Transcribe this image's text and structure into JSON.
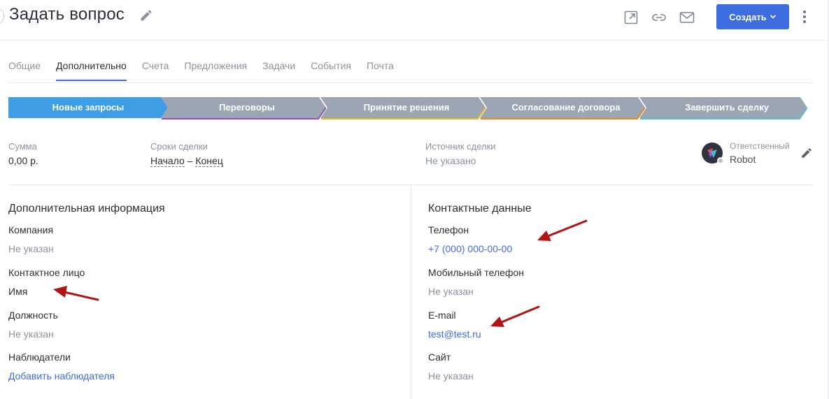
{
  "header": {
    "title": "Задать вопрос",
    "create_label": "Создать",
    "accent": "#3d6de0"
  },
  "icons": [
    "edit-icon",
    "open-external-icon",
    "link-icon",
    "mail-icon",
    "chevron-down-icon",
    "more-vertical-icon"
  ],
  "tabs": [
    {
      "label": "Общие",
      "active": false
    },
    {
      "label": "Дополнительно",
      "active": true
    },
    {
      "label": "Счета",
      "active": false
    },
    {
      "label": "Предложения",
      "active": false
    },
    {
      "label": "Задачи",
      "active": false
    },
    {
      "label": "События",
      "active": false
    },
    {
      "label": "Почта",
      "active": false
    }
  ],
  "pipeline": [
    {
      "label": "Новые запросы",
      "color": "#3d9ee5",
      "active": true
    },
    {
      "label": "Переговоры",
      "color": "#9ba5b3",
      "underline": "#8e54b7"
    },
    {
      "label": "Принятие решения",
      "color": "#9ba5b3",
      "underline": "#e6b820"
    },
    {
      "label": "Согласование договора",
      "color": "#9ba5b3",
      "underline": "#e88a1f"
    },
    {
      "label": "Завершить сделку",
      "color": "#9ba5b3",
      "underline": "#5bc0c8"
    }
  ],
  "summary": {
    "sum_label": "Сумма",
    "sum_value": "0,00 р.",
    "terms_label": "Сроки сделки",
    "terms_start": "Начало",
    "terms_sep": "–",
    "terms_end": "Конец",
    "source_label": "Источник сделки",
    "source_value": "Не указано",
    "responsible_label": "Ответственный",
    "responsible_value": "Robot"
  },
  "additional": {
    "title": "Дополнительная информация",
    "company_label": "Компания",
    "company_value": "Не указан",
    "contact_label": "Контактное лицо",
    "contact_value": "Имя",
    "position_label": "Должность",
    "position_value": "Не указан",
    "observers_label": "Наблюдатели",
    "observers_action": "Добавить наблюдателя"
  },
  "contacts": {
    "title": "Контактные данные",
    "phone_label": "Телефон",
    "phone_value": "+7 (000) 000-00-00",
    "mobile_label": "Мобильный телефон",
    "mobile_value": "Не указан",
    "email_label": "E-mail",
    "email_value": "test@test.ru",
    "site_label": "Сайт",
    "site_value": "Не указан"
  },
  "annotation_color": "#b01414"
}
